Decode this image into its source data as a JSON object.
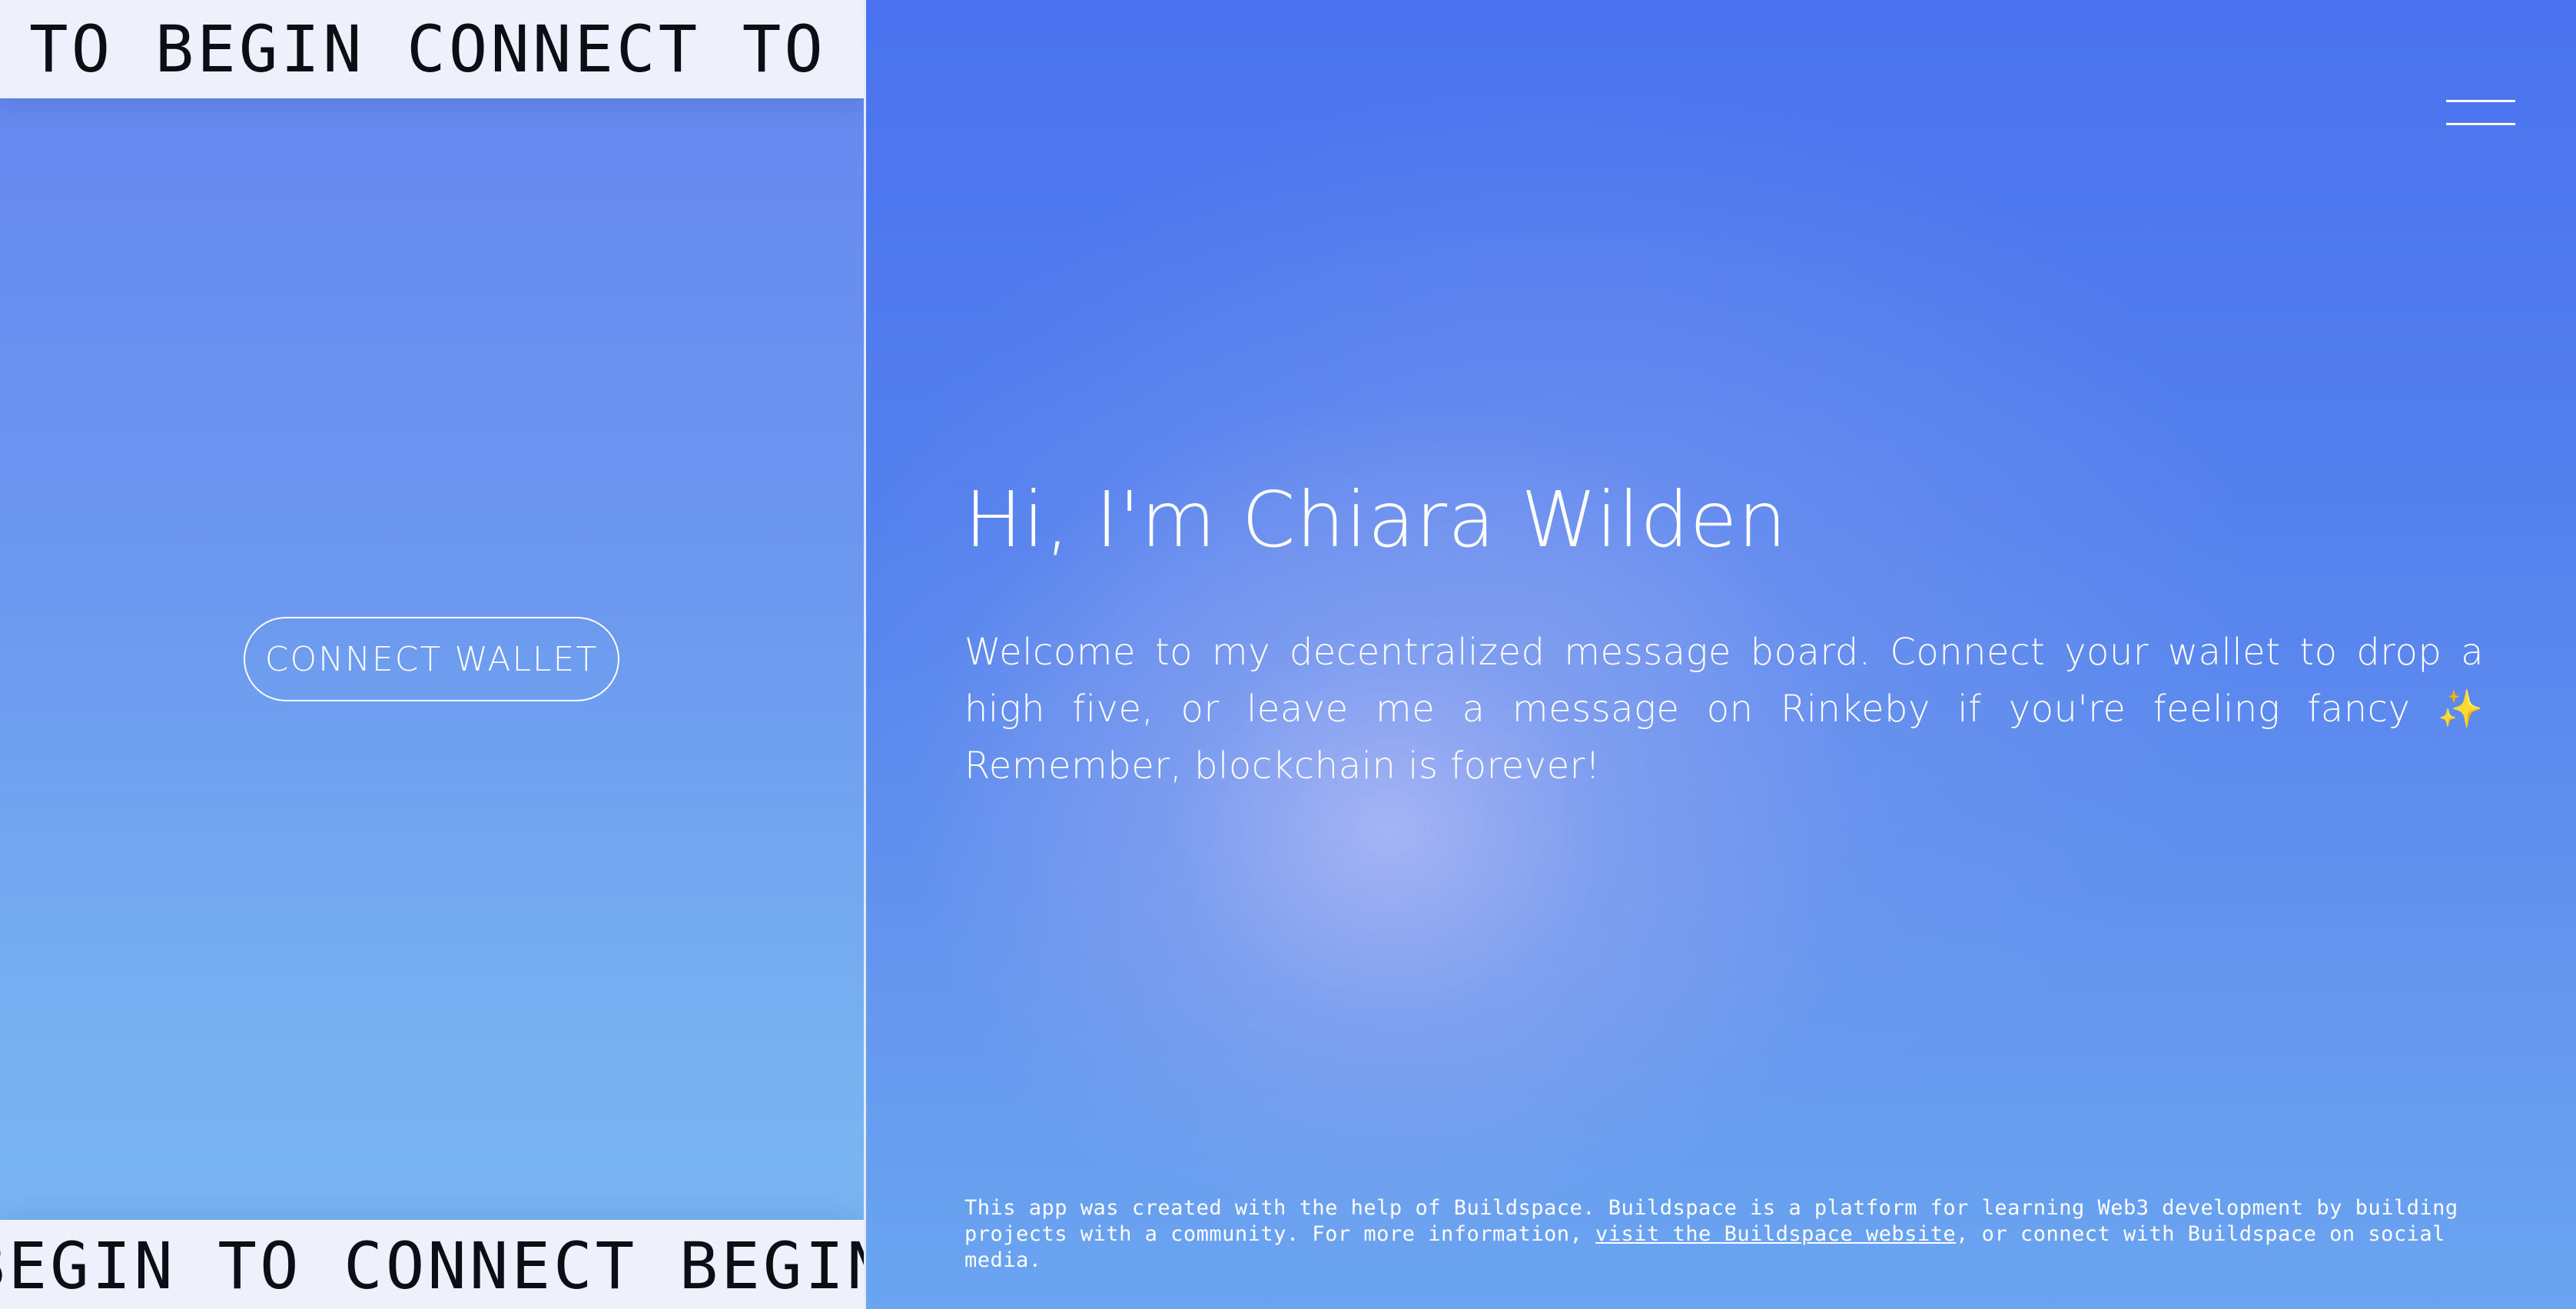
{
  "marquee": {
    "top_text": "TO BEGIN CONNECT TO BEGIN CONNECT TO BEGIN",
    "bottom_text": "BEGIN TO CONNECT BEGIN TO CONNECT BEGIN TO"
  },
  "left_panel": {
    "connect_button_label": "CONNECT WALLET"
  },
  "right_panel": {
    "title": "Hi, I'm Chiara Wilden",
    "intro": "Welcome to my decentralized message board. Connect your wallet to drop a high five, or leave me a message on Rinkeby if you're feeling fancy ✨ Remember, blockchain is forever!",
    "footer": {
      "text_before": "This app was created with the help of Buildspace. Buildspace is a platform for learning Web3 development by building projects with a community. For more information, ",
      "link_text": "visit the Buildspace website",
      "text_after": ", or connect with Buildspace on social media."
    }
  },
  "icons": {
    "menu": "hamburger-menu-icon"
  },
  "colors": {
    "accent_blue": "#4b73ef",
    "marquee_bg": "#eef1fc",
    "text": "#ffffff"
  }
}
